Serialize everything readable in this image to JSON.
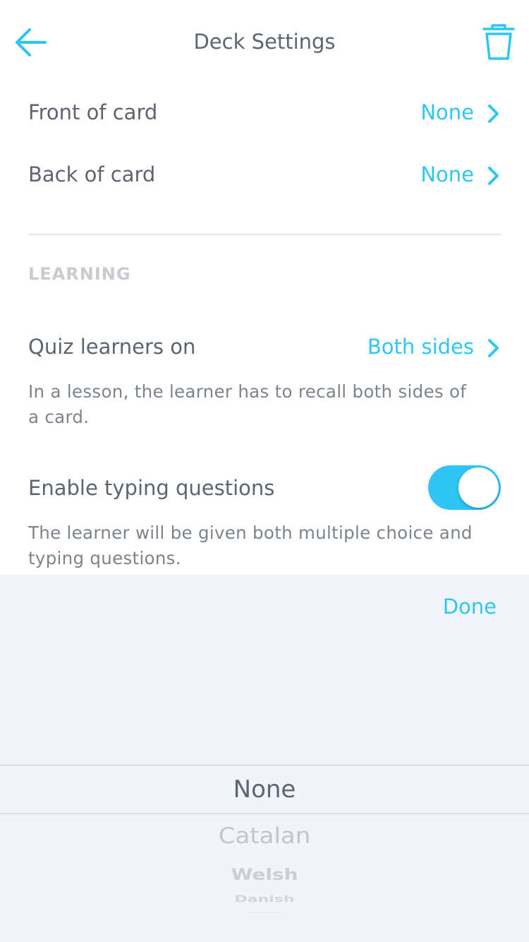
{
  "header": {
    "title": "Deck Settings",
    "back_icon": "arrow-left-icon",
    "delete_icon": "trash-icon"
  },
  "rows": {
    "front": {
      "label": "Front of card",
      "value": "None"
    },
    "back": {
      "label": "Back of card",
      "value": "None"
    }
  },
  "learning": {
    "section_title": "LEARNING",
    "quiz": {
      "label": "Quiz learners on",
      "value": "Both sides",
      "description_line1": "In a lesson, the learner has to recall both sides of",
      "description_line2": "a card."
    },
    "typing": {
      "label": "Enable typing questions",
      "enabled": true,
      "description_line1": "The learner will be given both multiple choice and",
      "description_line2": "typing questions."
    }
  },
  "picker": {
    "done_label": "Done",
    "selected": "None",
    "options": [
      "None",
      "Catalan",
      "Welsh",
      "Danish"
    ]
  },
  "colors": {
    "accent": "#2fc6f5",
    "text": "#5d6570",
    "muted": "#7d848d",
    "section": "#c8ccd1",
    "picker_bg": "#f1f5f9"
  }
}
